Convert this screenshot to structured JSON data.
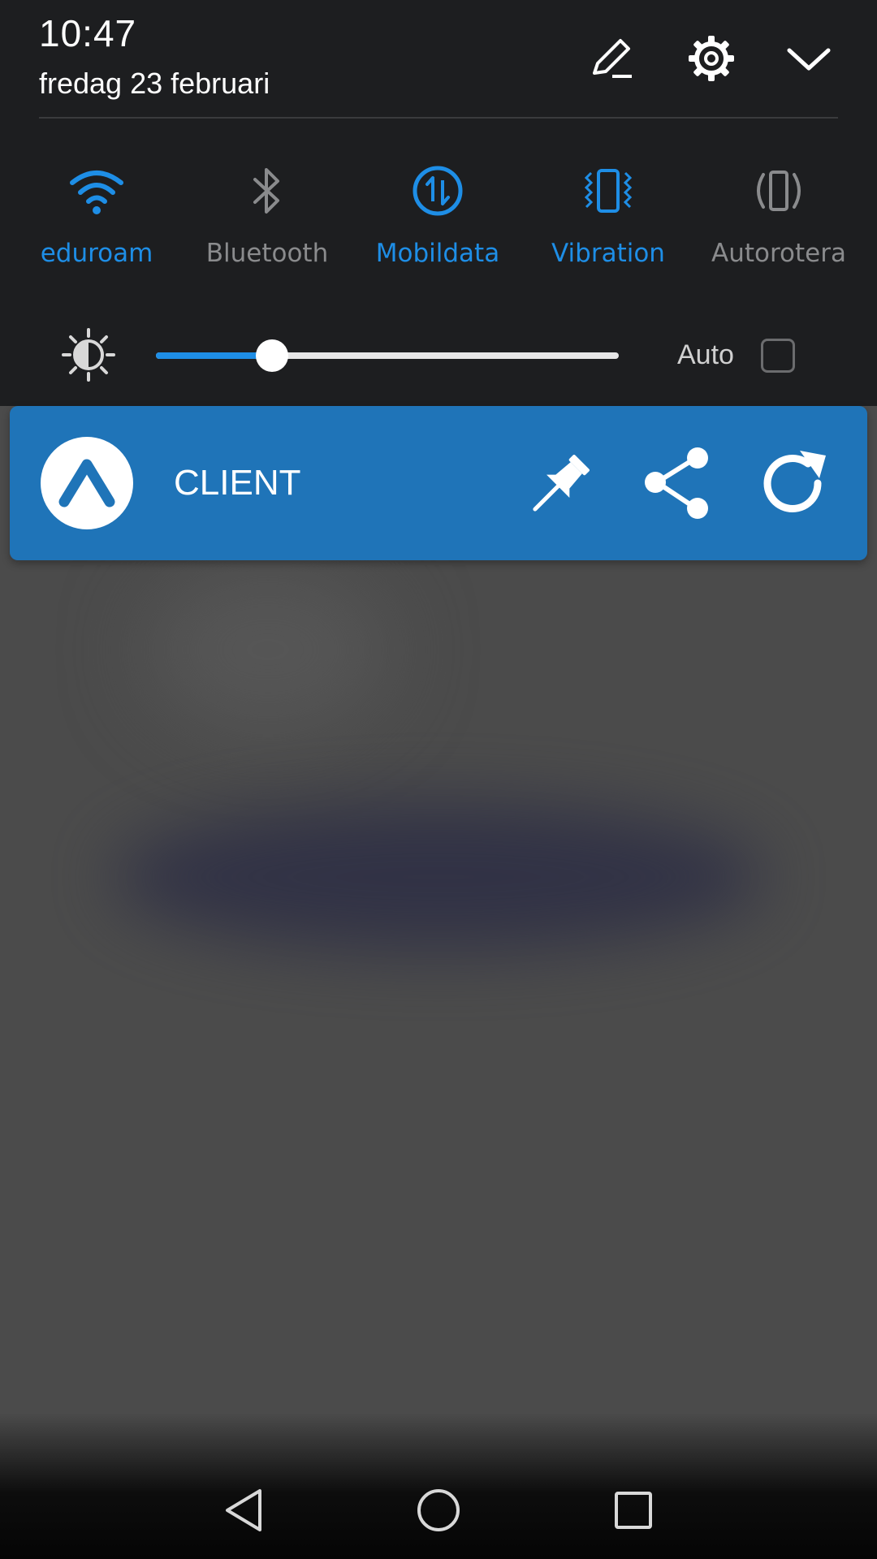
{
  "status": {
    "time": "10:47",
    "date": "fredag 23 februari"
  },
  "header_icons": [
    "edit-icon",
    "gear-icon",
    "chevron-down-icon"
  ],
  "quick_tiles": [
    {
      "label": "eduroam",
      "icon": "wifi-icon",
      "active": true
    },
    {
      "label": "Bluetooth",
      "icon": "bluetooth-icon",
      "active": false
    },
    {
      "label": "Mobildata",
      "icon": "mobile-data-icon",
      "active": true
    },
    {
      "label": "Vibration",
      "icon": "vibration-icon",
      "active": true
    },
    {
      "label": "Autorotera",
      "icon": "auto-rotate-icon",
      "active": false
    }
  ],
  "brightness": {
    "level": 0.25,
    "auto_label": "Auto",
    "auto_checked": false
  },
  "notification": {
    "app_title": "CLIENT",
    "actions": [
      "pin-icon",
      "share-icon",
      "refresh-icon"
    ]
  },
  "colors": {
    "accent": "#1e8ee6",
    "inactive": "#8a8b8d",
    "shade_bg": "#1d1e20",
    "notification_bg": "#1f74b8"
  },
  "navigation": [
    "back-icon",
    "home-icon",
    "recents-icon"
  ]
}
